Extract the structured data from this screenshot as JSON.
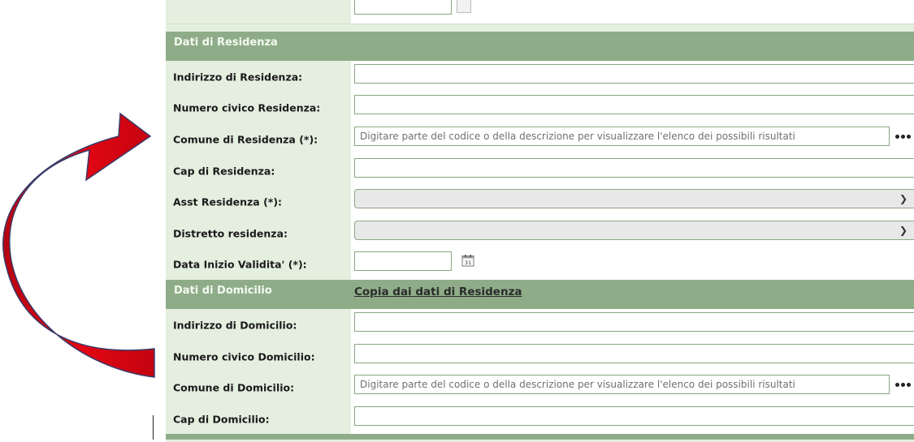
{
  "residenza": {
    "header": "Dati di Residenza",
    "indirizzo_label": "Indirizzo di Residenza:",
    "civico_label": "Numero civico Residenza:",
    "comune_label": "Comune di Residenza (*):",
    "comune_placeholder": "Digitare parte del codice o della descrizione per visualizzare l'elenco dei possibili risultati",
    "cap_label": "Cap di Residenza:",
    "asst_label": "Asst Residenza (*):",
    "distretto_label": "Distretto residenza:",
    "data_label": "Data Inizio Validita' (*):"
  },
  "domicilio": {
    "header": "Dati di Domicilio",
    "copy_link": "Copia dai dati di Residenza",
    "indirizzo_label": "Indirizzo di Domicilio:",
    "civico_label": "Numero civico Domicilio:",
    "comune_label": "Comune di Domicilio:",
    "comune_placeholder": "Digitare parte del codice o della descrizione per visualizzare l'elenco dei possibili risultati",
    "cap_label": "Cap di Domicilio:"
  },
  "icons": {
    "lookup": "ellipsis-icon",
    "dropdown": "chevron-down-icon",
    "calendar": "calendar-icon",
    "calendar_day": "31",
    "annotation": "curved-arrow-icon"
  },
  "colors": {
    "header_bg": "#8eac88",
    "label_bg": "#e5efe0",
    "field_border": "#8aa77f",
    "arrow_fill": "#e30613"
  }
}
